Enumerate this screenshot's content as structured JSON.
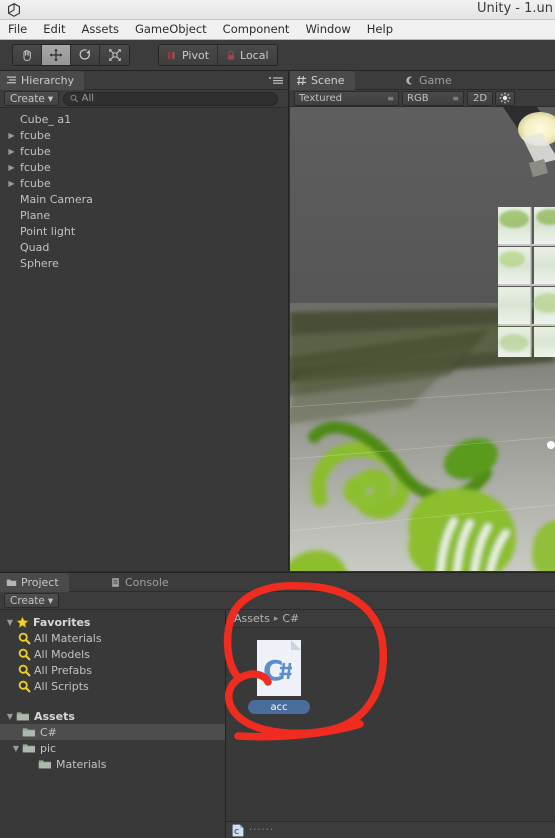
{
  "window": {
    "title": "Unity - 1.un",
    "logo_icon": "unity-logo-icon"
  },
  "menubar": {
    "items": [
      {
        "label": "File"
      },
      {
        "label": "Edit"
      },
      {
        "label": "Assets"
      },
      {
        "label": "GameObject"
      },
      {
        "label": "Component"
      },
      {
        "label": "Window"
      },
      {
        "label": "Help"
      }
    ]
  },
  "toolbar": {
    "tools": [
      {
        "name": "hand-tool",
        "icon": "hand-icon",
        "active": false
      },
      {
        "name": "move-tool",
        "icon": "move-arrows-icon",
        "active": true
      },
      {
        "name": "rotate-tool",
        "icon": "rotate-icon",
        "active": false
      },
      {
        "name": "scale-tool",
        "icon": "scale-icon",
        "active": false
      }
    ],
    "pivot_label": "Pivot",
    "pivot_icon": "pivot-icon",
    "local_label": "Local",
    "local_icon": "lock-icon"
  },
  "hierarchy": {
    "tab_label": "Hierarchy",
    "tab_icon": "hierarchy-icon",
    "menu_icon": "panel-menu-icon",
    "create_label": "Create",
    "create_caret": "▾",
    "search_icon": "search-icon",
    "search_value": "All",
    "search_placeholder": "All",
    "items": [
      {
        "label": "Cube_ a1",
        "expandable": false
      },
      {
        "label": "fcube",
        "expandable": true
      },
      {
        "label": "fcube",
        "expandable": true
      },
      {
        "label": "fcube",
        "expandable": true
      },
      {
        "label": "fcube",
        "expandable": true
      },
      {
        "label": "Main Camera",
        "expandable": false
      },
      {
        "label": "Plane",
        "expandable": false
      },
      {
        "label": "Point light",
        "expandable": false
      },
      {
        "label": "Quad",
        "expandable": false
      },
      {
        "label": "Sphere",
        "expandable": false
      }
    ]
  },
  "scene": {
    "tabs": [
      {
        "label": "Scene",
        "icon": "scene-grid-icon",
        "active": true
      },
      {
        "label": "Game",
        "icon": "game-icon",
        "active": false
      }
    ],
    "draw_mode": "Textured",
    "color_mode": "RGB",
    "two_d_label": "2D",
    "light_icon": "light-sun-icon",
    "dropdown_caret": "≣"
  },
  "project": {
    "tabs": [
      {
        "label": "Project",
        "icon": "project-folder-icon",
        "active": true
      },
      {
        "label": "Console",
        "icon": "console-icon",
        "active": false
      }
    ],
    "create_label": "Create",
    "create_caret": "▾",
    "tree": [
      {
        "label": "Favorites",
        "icon": "star-icon",
        "depth": 0,
        "expanded": true,
        "bold": true,
        "selected": false
      },
      {
        "label": "All Materials",
        "icon": "search-saved-icon",
        "depth": 1,
        "expanded": null,
        "bold": false,
        "selected": false
      },
      {
        "label": "All Models",
        "icon": "search-saved-icon",
        "depth": 1,
        "expanded": null,
        "bold": false,
        "selected": false
      },
      {
        "label": "All Prefabs",
        "icon": "search-saved-icon",
        "depth": 1,
        "expanded": null,
        "bold": false,
        "selected": false
      },
      {
        "label": "All Scripts",
        "icon": "search-saved-icon",
        "depth": 1,
        "expanded": null,
        "bold": false,
        "selected": false
      },
      {
        "label": "",
        "icon": "",
        "depth": 0,
        "expanded": null,
        "bold": false,
        "selected": false
      },
      {
        "label": "Assets",
        "icon": "folder-icon",
        "depth": 0,
        "expanded": true,
        "bold": true,
        "selected": false
      },
      {
        "label": "C#",
        "icon": "folder-icon",
        "depth": 1,
        "expanded": null,
        "bold": false,
        "selected": true
      },
      {
        "label": "pic",
        "icon": "folder-icon",
        "depth": 1,
        "expanded": true,
        "bold": false,
        "selected": false
      },
      {
        "label": "Materials",
        "icon": "folder-icon",
        "depth": 2,
        "expanded": null,
        "bold": false,
        "selected": false
      }
    ],
    "breadcrumb": [
      {
        "label": "Assets"
      },
      {
        "label": "C#"
      }
    ],
    "breadcrumb_separator": "▸",
    "assets": [
      {
        "label": "acc",
        "icon": "csharp-script-icon",
        "selected": true
      }
    ],
    "status_text": "······",
    "status_icon": "csharp-file-icon"
  },
  "annotation": {
    "color": "#f02b20",
    "shape": "hand-drawn-circle-around-asset"
  },
  "colors": {
    "panel_bg": "#393939",
    "toolbar_bg": "#3c3c3c",
    "tab_active": "#4a4a4a",
    "text": "#c2c2c2",
    "selection": "#4a6d9c",
    "annotation_red": "#f02b20",
    "favorites_yellow": "#f2d024"
  }
}
